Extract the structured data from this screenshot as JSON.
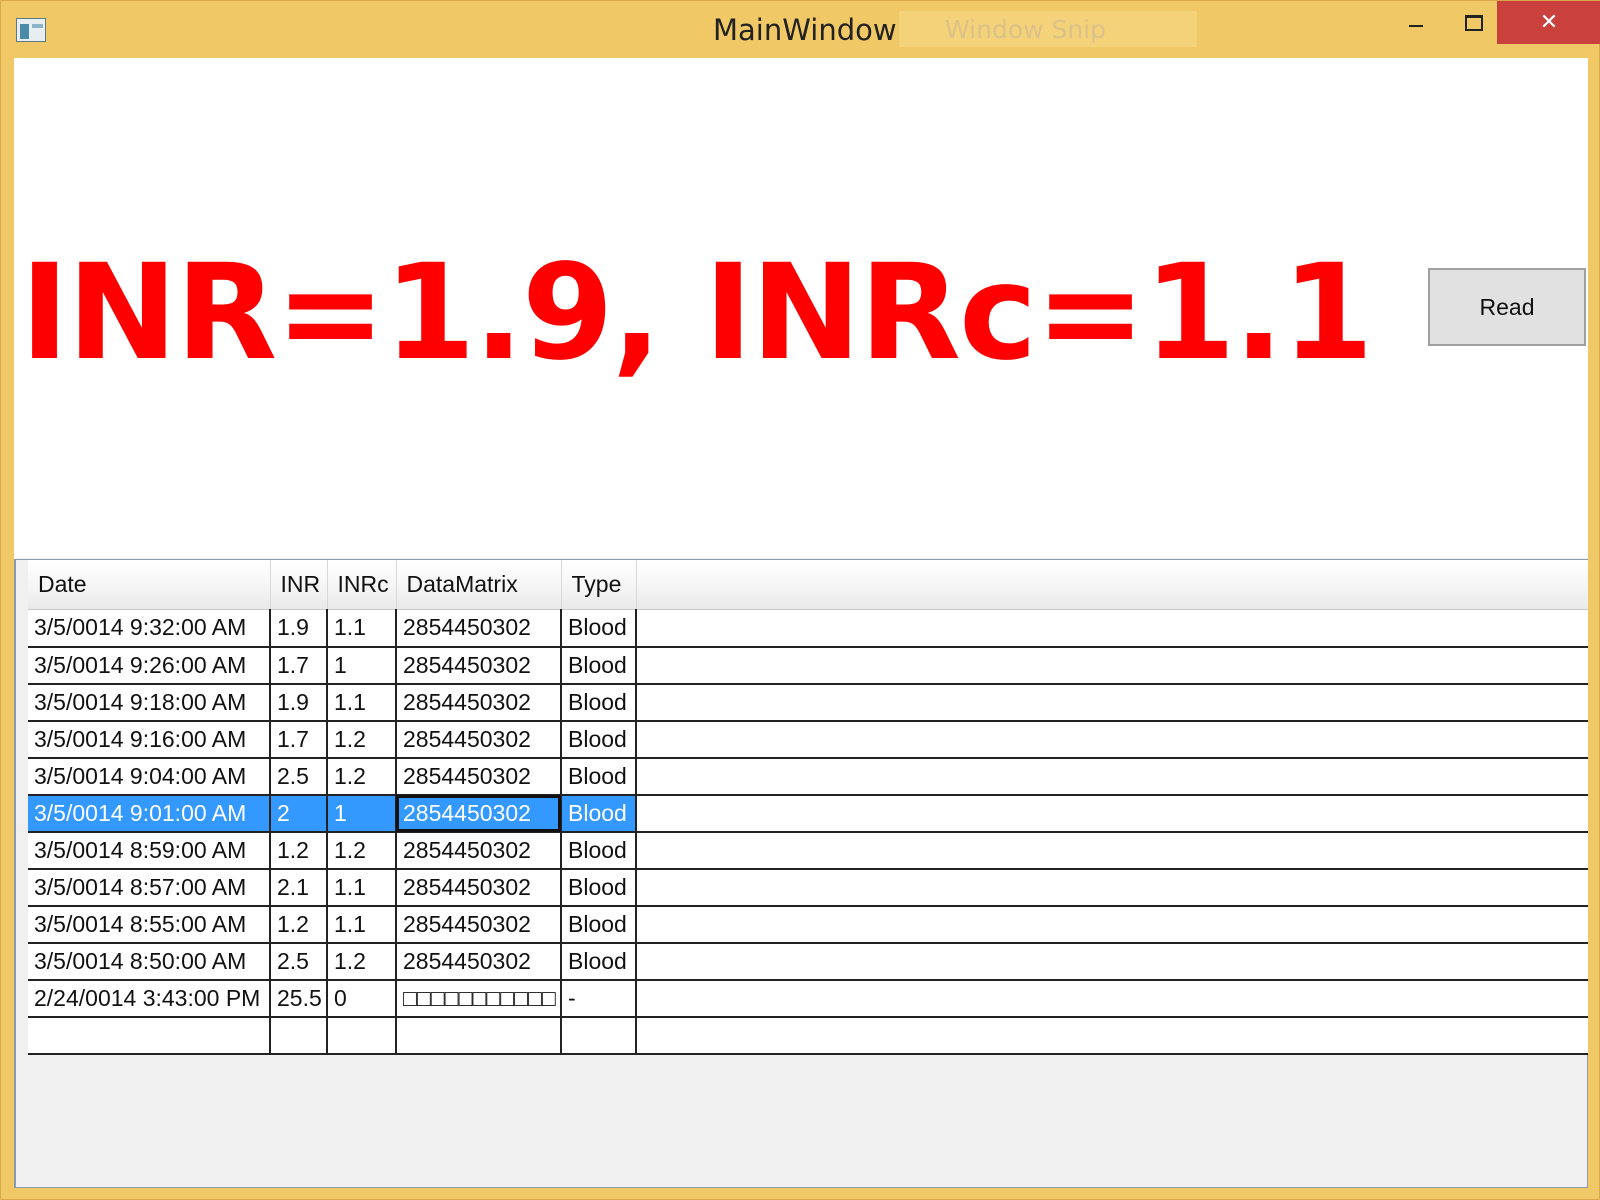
{
  "window": {
    "title": "MainWindow",
    "snip_label": "Window Snip",
    "close_glyph": "✕"
  },
  "reading": {
    "text": "INR=1.9, INRc=1.1",
    "color": "#ff0000"
  },
  "read_button": {
    "label": "Read"
  },
  "table": {
    "columns": [
      "Date",
      "INR",
      "INRc",
      "DataMatrix",
      "Type"
    ],
    "rows": [
      [
        "3/5/0014 9:32:00 AM",
        "1.9",
        "1.1",
        "2854450302",
        "Blood"
      ],
      [
        "3/5/0014 9:26:00 AM",
        "1.7",
        "1",
        "2854450302",
        "Blood"
      ],
      [
        "3/5/0014 9:18:00 AM",
        "1.9",
        "1.1",
        "2854450302",
        "Blood"
      ],
      [
        "3/5/0014 9:16:00 AM",
        "1.7",
        "1.2",
        "2854450302",
        "Blood"
      ],
      [
        "3/5/0014 9:04:00 AM",
        "2.5",
        "1.2",
        "2854450302",
        "Blood"
      ],
      [
        "3/5/0014 9:01:00 AM",
        "2",
        "1",
        "2854450302",
        "Blood"
      ],
      [
        "3/5/0014 8:59:00 AM",
        "1.2",
        "1.2",
        "2854450302",
        "Blood"
      ],
      [
        "3/5/0014 8:57:00 AM",
        "2.1",
        "1.1",
        "2854450302",
        "Blood"
      ],
      [
        "3/5/0014 8:55:00 AM",
        "1.2",
        "1.1",
        "2854450302",
        "Blood"
      ],
      [
        "3/5/0014 8:50:00 AM",
        "2.5",
        "1.2",
        "2854450302",
        "Blood"
      ],
      [
        "2/24/0014 3:43:00 PM",
        "25.5",
        "0",
        "□□□□□□□□□□□",
        "-"
      ],
      [
        "",
        "",
        "",
        "",
        ""
      ]
    ],
    "selected_row": 5,
    "selection_color": "#3399ff"
  }
}
